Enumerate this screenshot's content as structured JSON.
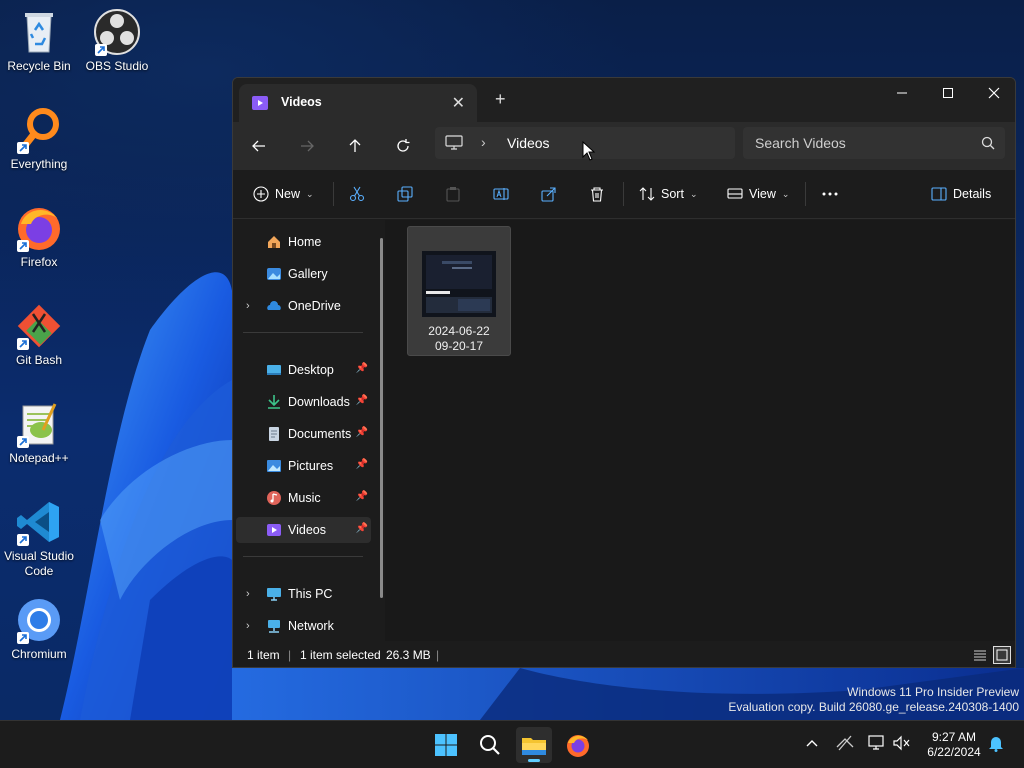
{
  "desktop": {
    "icons": [
      {
        "label": "Recycle Bin"
      },
      {
        "label": "OBS Studio"
      },
      {
        "label": "Everything"
      },
      {
        "label": "Firefox"
      },
      {
        "label": "Git Bash"
      },
      {
        "label": "Notepad++"
      },
      {
        "label": "Visual Studio Code"
      },
      {
        "label": "Chromium"
      }
    ]
  },
  "window": {
    "tab_title": "Videos",
    "breadcrumb": "Videos",
    "search_placeholder": "Search Videos",
    "toolbar": {
      "new_label": "New",
      "sort_label": "Sort",
      "view_label": "View",
      "details_label": "Details"
    },
    "sidebar": {
      "items": [
        {
          "label": "Home"
        },
        {
          "label": "Gallery"
        },
        {
          "label": "OneDrive"
        },
        {
          "label": "Desktop"
        },
        {
          "label": "Downloads"
        },
        {
          "label": "Documents"
        },
        {
          "label": "Pictures"
        },
        {
          "label": "Music"
        },
        {
          "label": "Videos"
        },
        {
          "label": "This PC"
        },
        {
          "label": "Network"
        }
      ]
    },
    "files": [
      {
        "name_line1": "2024-06-22",
        "name_line2": "09-20-17"
      }
    ],
    "status": {
      "item_count": "1 item",
      "selected": "1 item selected",
      "size": "26.3 MB"
    }
  },
  "watermark": {
    "line1": "Windows 11 Pro Insider Preview",
    "line2": "Evaluation copy. Build 26080.ge_release.240308-1400"
  },
  "clock": {
    "time": "9:27 AM",
    "date": "6/22/2024"
  },
  "colors": {
    "accent": "#60cdff",
    "window_bg": "#1c1c1c",
    "selection_bg": "#3b3b3b"
  }
}
